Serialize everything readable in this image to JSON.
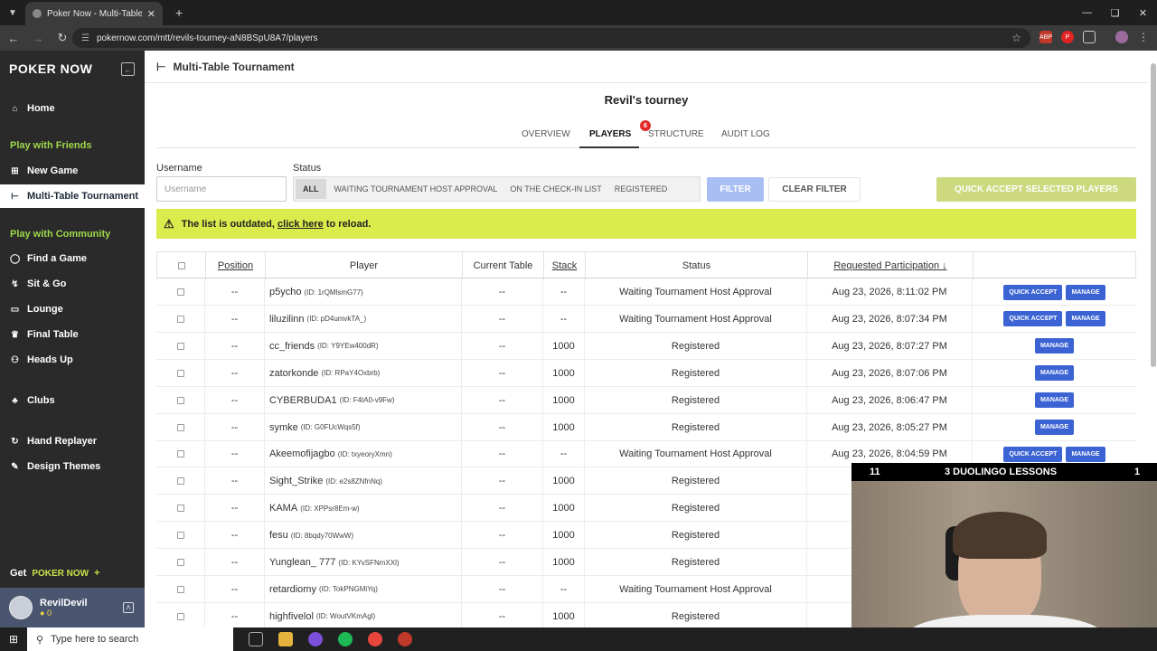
{
  "browser": {
    "tab_title": "Poker Now - Multi-Table Tournament",
    "url": "pokernow.com/mtt/revils-tourney-aN8BSpU8A7/players",
    "extensions": [
      "ABP",
      "P"
    ]
  },
  "sidebar": {
    "logo": "POKER NOW",
    "home": "Home",
    "section_friends": "Play with Friends",
    "new_game": "New Game",
    "mtt": "Multi-Table Tournament",
    "section_community": "Play with Community",
    "find_game": "Find a Game",
    "sit_go": "Sit & Go",
    "lounge": "Lounge",
    "final_table": "Final Table",
    "heads_up": "Heads Up",
    "clubs": "Clubs",
    "hand_replayer": "Hand Replayer",
    "design_themes": "Design Themes",
    "get_label": "Get",
    "get_brand": "POKER NOW",
    "get_plus": "+",
    "user_name": "RevilDevil",
    "user_coins": "0"
  },
  "header": {
    "title": "Multi-Table Tournament",
    "tourney_name": "Revil's tourney"
  },
  "tabs": {
    "overview": "OVERVIEW",
    "players": "PLAYERS",
    "players_badge": "6",
    "structure": "STRUCTURE",
    "audit_log": "AUDIT LOG"
  },
  "filters": {
    "username_label": "Username",
    "username_placeholder": "Username",
    "status_label": "Status",
    "status_options": [
      "ALL",
      "WAITING TOURNAMENT HOST APPROVAL",
      "ON THE CHECK-IN LIST",
      "REGISTERED"
    ],
    "filter_button": "FILTER",
    "clear_button": "CLEAR FILTER",
    "quick_accept_selected": "QUICK ACCEPT SELECTED PLAYERS"
  },
  "alert": {
    "prefix": "The list is outdated,",
    "link": "click here",
    "suffix": "to reload."
  },
  "table": {
    "columns": [
      "Position",
      "Player",
      "Current Table",
      "Stack",
      "Status",
      "Requested Participation ↓"
    ],
    "action_quick": "QUICK ACCEPT",
    "action_manage": "MANAGE",
    "rows": [
      {
        "position": "--",
        "name": "p5ycho",
        "id": "(ID: 1rQMlsmG77)",
        "table": "--",
        "stack": "--",
        "status": "Waiting Tournament Host Approval",
        "requested": "Aug 23, 2026, 8:11:02 PM",
        "quick": true
      },
      {
        "position": "--",
        "name": "liluzilinn",
        "id": "(ID: pD4umvkTA_)",
        "table": "--",
        "stack": "--",
        "status": "Waiting Tournament Host Approval",
        "requested": "Aug 23, 2026, 8:07:34 PM",
        "quick": true
      },
      {
        "position": "--",
        "name": "cc_friends",
        "id": "(ID: Y9YEw400dR)",
        "table": "--",
        "stack": "1000",
        "status": "Registered",
        "requested": "Aug 23, 2026, 8:07:27 PM",
        "quick": false
      },
      {
        "position": "--",
        "name": "zatorkonde",
        "id": "(ID: RPaY4Oxbrb)",
        "table": "--",
        "stack": "1000",
        "status": "Registered",
        "requested": "Aug 23, 2026, 8:07:06 PM",
        "quick": false
      },
      {
        "position": "--",
        "name": "CYBERBUDA1",
        "id": "(ID: F4tA0-v9Fw)",
        "table": "--",
        "stack": "1000",
        "status": "Registered",
        "requested": "Aug 23, 2026, 8:06:47 PM",
        "quick": false
      },
      {
        "position": "--",
        "name": "symke",
        "id": "(ID: G0FUcWqs5f)",
        "table": "--",
        "stack": "1000",
        "status": "Registered",
        "requested": "Aug 23, 2026, 8:05:27 PM",
        "quick": false
      },
      {
        "position": "--",
        "name": "Akeemofijagbo",
        "id": "(ID: txyeoryXmn)",
        "table": "--",
        "stack": "--",
        "status": "Waiting Tournament Host Approval",
        "requested": "Aug 23, 2026, 8:04:59 PM",
        "quick": true
      },
      {
        "position": "--",
        "name": "Sight_Strike",
        "id": "(ID: e2s8ZNfnNq)",
        "table": "--",
        "stack": "1000",
        "status": "Registered",
        "requested": "Aug",
        "quick": false
      },
      {
        "position": "--",
        "name": "KAMA",
        "id": "(ID: XPPsr8Em-w)",
        "table": "--",
        "stack": "1000",
        "status": "Registered",
        "requested": "Aug",
        "quick": false
      },
      {
        "position": "--",
        "name": "fesu",
        "id": "(ID: 8bqdy70WwW)",
        "table": "--",
        "stack": "1000",
        "status": "Registered",
        "requested": "Aug",
        "quick": false
      },
      {
        "position": "--",
        "name": "Yunglean_ 777",
        "id": "(ID: KYvSFNmXXl)",
        "table": "--",
        "stack": "1000",
        "status": "Registered",
        "requested": "Aug",
        "quick": false
      },
      {
        "position": "--",
        "name": "retardiomy",
        "id": "(ID: TokPNGMiYq)",
        "table": "--",
        "stack": "--",
        "status": "Waiting Tournament Host Approval",
        "requested": "Aug",
        "quick": false
      },
      {
        "position": "--",
        "name": "highfivelol",
        "id": "(ID: WoutVKmAgl)",
        "table": "--",
        "stack": "1000",
        "status": "Registered",
        "requested": "Aug",
        "quick": false
      }
    ]
  },
  "overlay": {
    "left": "11",
    "center": "3 DUOLINGO LESSONS",
    "right": "1"
  },
  "taskbar": {
    "search_placeholder": "Type here to search"
  }
}
